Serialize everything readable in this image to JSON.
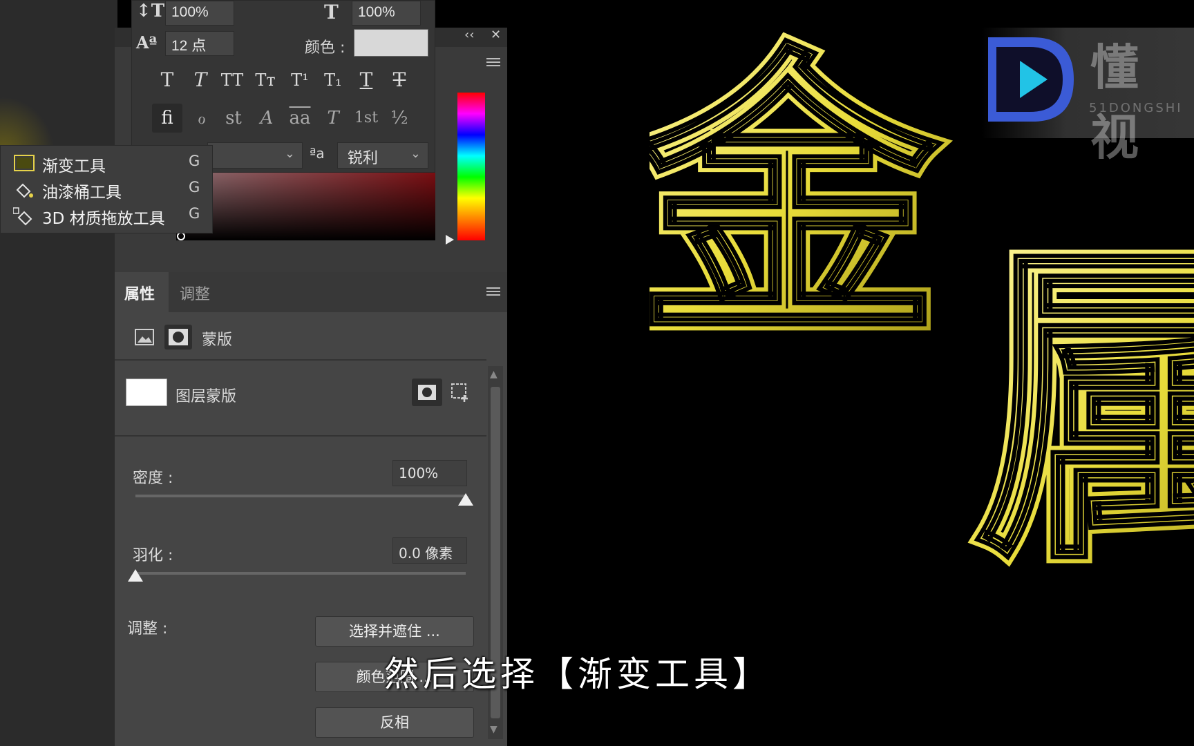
{
  "character_panel": {
    "vertical_scale": "100%",
    "horizontal_scale": "100%",
    "baseline_shift": "12 点",
    "color_label": "颜色 :",
    "color_value": "#d8d8d8",
    "style_buttons": [
      "T",
      "T",
      "TT",
      "Tт",
      "T¹",
      "T₁",
      "T",
      "T"
    ],
    "opentype_buttons": [
      "fi",
      "ℴ",
      "st",
      "A",
      "aa",
      "T",
      "1st",
      "½"
    ],
    "antialias_prefix": "ªa",
    "antialias_value": "锐利"
  },
  "tool_flyout": {
    "items": [
      {
        "label": "渐变工具",
        "shortcut": "G",
        "icon": "gradient-tool-icon"
      },
      {
        "label": "油漆桶工具",
        "shortcut": "G",
        "icon": "paint-bucket-icon"
      },
      {
        "label": "3D 材质拖放工具",
        "shortcut": "G",
        "icon": "3d-material-drop-icon"
      }
    ]
  },
  "panel_header": {
    "collapse": "‹‹",
    "close": "✕"
  },
  "properties": {
    "tabs": [
      "属性",
      "调整"
    ],
    "mask_type_label": "蒙版",
    "layer_mask_label": "图层蒙版",
    "density_label": "密度 :",
    "density_value": "100%",
    "density_level": 1.0,
    "feather_label": "羽化 :",
    "feather_value": "0.0 像素",
    "feather_level": 0.0,
    "adjust_label": "调整 :",
    "buttons": [
      "选择并遮住 ...",
      "颜色范围 ...",
      "反相"
    ]
  },
  "canvas": {
    "chars": [
      "金",
      "属"
    ],
    "text_color": "#e8dc3a"
  },
  "brand": {
    "name": "懂 视",
    "sub": "51DONGSHI"
  },
  "subtitle": "然后选择【渐变工具】"
}
